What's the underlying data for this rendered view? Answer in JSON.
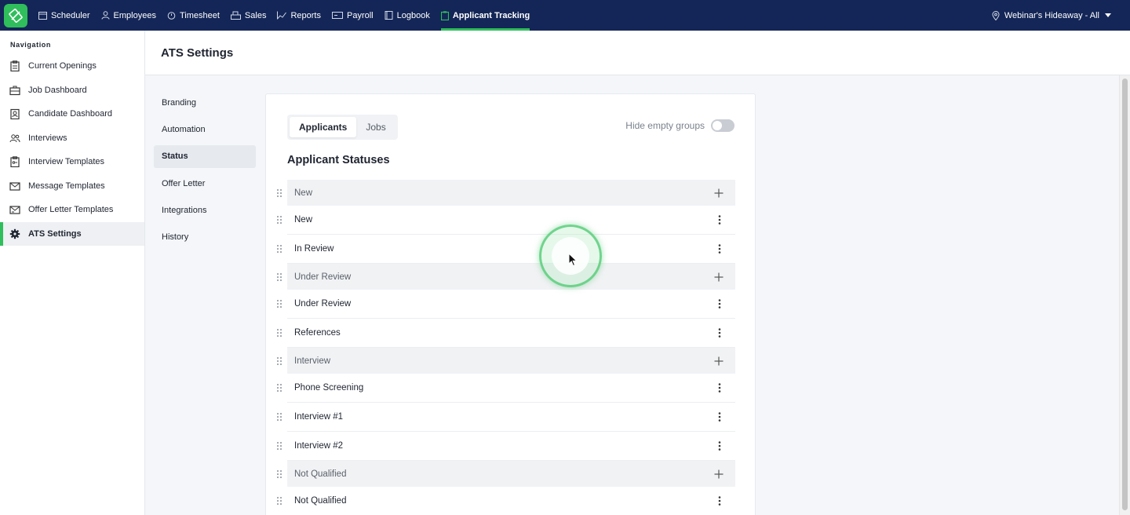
{
  "topnav": {
    "items": [
      {
        "label": "Scheduler",
        "icon": "calendar-icon"
      },
      {
        "label": "Employees",
        "icon": "person-icon"
      },
      {
        "label": "Timesheet",
        "icon": "timer-icon"
      },
      {
        "label": "Sales",
        "icon": "register-icon"
      },
      {
        "label": "Reports",
        "icon": "trend-icon"
      },
      {
        "label": "Payroll",
        "icon": "payroll-icon"
      },
      {
        "label": "Logbook",
        "icon": "book-icon"
      },
      {
        "label": "Applicant Tracking",
        "icon": "clipboard-icon",
        "active": true
      }
    ],
    "location": "Webinar's Hideaway - All"
  },
  "sidebar": {
    "heading": "Navigation",
    "items": [
      {
        "label": "Current Openings",
        "icon": "clipboard-icon"
      },
      {
        "label": "Job Dashboard",
        "icon": "briefcase-icon"
      },
      {
        "label": "Candidate Dashboard",
        "icon": "badge-icon"
      },
      {
        "label": "Interviews",
        "icon": "people-icon"
      },
      {
        "label": "Interview Templates",
        "icon": "template-icon"
      },
      {
        "label": "Message Templates",
        "icon": "envelope-icon"
      },
      {
        "label": "Offer Letter Templates",
        "icon": "letter-icon"
      },
      {
        "label": "ATS Settings",
        "icon": "gear-icon",
        "active": true
      }
    ]
  },
  "page": {
    "title": "ATS Settings"
  },
  "subnav": {
    "items": [
      "Branding",
      "Automation",
      "Status",
      "Offer Letter",
      "Integrations",
      "History"
    ],
    "active": "Status"
  },
  "card": {
    "tabs": [
      "Applicants",
      "Jobs"
    ],
    "active_tab": "Applicants",
    "toggle_label": "Hide empty groups",
    "toggle_on": false,
    "section_title": "Applicant Statuses",
    "rows": [
      {
        "type": "group",
        "label": "New"
      },
      {
        "type": "item",
        "label": "New"
      },
      {
        "type": "item",
        "label": "In Review"
      },
      {
        "type": "group",
        "label": "Under Review"
      },
      {
        "type": "item",
        "label": "Under Review"
      },
      {
        "type": "item",
        "label": "References"
      },
      {
        "type": "group",
        "label": "Interview"
      },
      {
        "type": "item",
        "label": "Phone Screening"
      },
      {
        "type": "item",
        "label": "Interview #1"
      },
      {
        "type": "item",
        "label": "Interview #2"
      },
      {
        "type": "group",
        "label": "Not Qualified"
      },
      {
        "type": "item",
        "label": "Not Qualified"
      }
    ]
  },
  "colors": {
    "navy": "#142657",
    "accent": "#2fbe5b"
  }
}
